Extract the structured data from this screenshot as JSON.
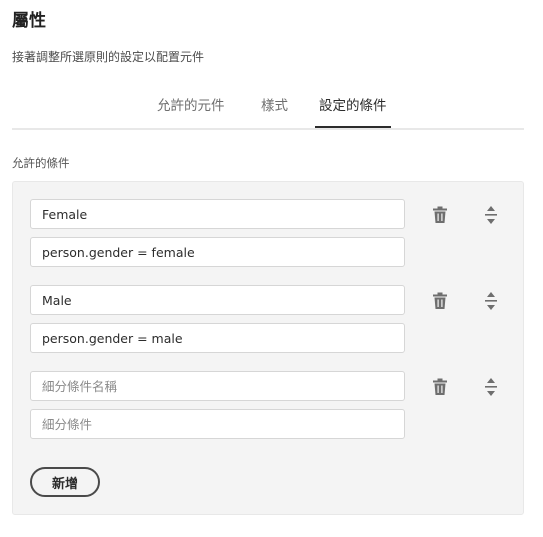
{
  "header": {
    "title": "屬性",
    "description": "接著調整所選原則的設定以配置元件"
  },
  "tabs": [
    {
      "label": "允許的元件",
      "active": false
    },
    {
      "label": "樣式",
      "active": false
    },
    {
      "label": "設定的條件",
      "active": true
    }
  ],
  "section": {
    "label": "允許的條件"
  },
  "conditions": [
    {
      "name_value": "Female",
      "condition_value": "person.gender = female",
      "name_placeholder": "細分條件名稱",
      "condition_placeholder": "細分條件"
    },
    {
      "name_value": "Male",
      "condition_value": "person.gender = male",
      "name_placeholder": "細分條件名稱",
      "condition_placeholder": "細分條件"
    },
    {
      "name_value": "",
      "condition_value": "",
      "name_placeholder": "細分條件名稱",
      "condition_placeholder": "細分條件"
    }
  ],
  "add_button_label": "新增",
  "icons": {
    "delete": "trash-icon",
    "reorder": "reorder-icon"
  },
  "colors": {
    "text": "#2c2c2c",
    "icon": "#6e6e6e",
    "panel": "#f4f4f4"
  }
}
